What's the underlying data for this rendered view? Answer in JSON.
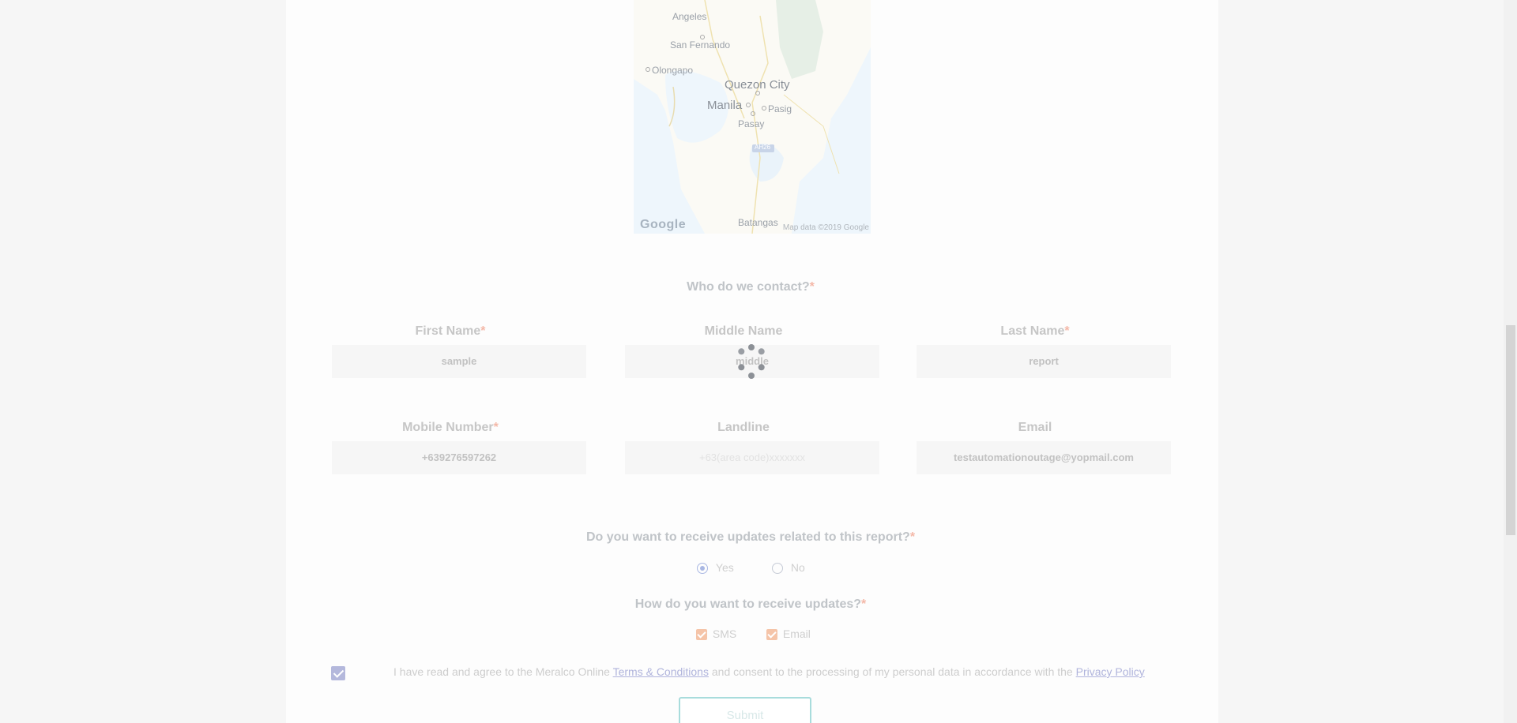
{
  "map": {
    "labels": [
      "Angeles",
      "San Fernando",
      "Olongapo",
      "Quezon City",
      "Manila",
      "Pasig",
      "Pasay",
      "AH26",
      "Batangas"
    ],
    "google_logo": "Google",
    "attribution": "Map data ©2019 Google"
  },
  "contact": {
    "title": "Who do we contact?",
    "required_mark": "*",
    "first_name": {
      "label": "First Name",
      "value": "sample"
    },
    "middle_name": {
      "label": "Middle Name",
      "value": "middle"
    },
    "last_name": {
      "label": "Last Name",
      "value": "report"
    },
    "mobile": {
      "label": "Mobile Number",
      "value": "+639276597262"
    },
    "landline": {
      "label": "Landline",
      "placeholder": "+63(area code)xxxxxxx"
    },
    "email": {
      "label": "Email",
      "value": "testautomationoutage@yopmail.com"
    }
  },
  "updates": {
    "question": "Do you want to receive updates related to this report?",
    "yes_label": "Yes",
    "no_label": "No",
    "selected": "Yes",
    "method_question": "How do you want to receive updates?",
    "sms_label": "SMS",
    "email_label": "Email"
  },
  "agreement": {
    "text_before": "I have read and agree to the Meralco Online ",
    "terms_link": "Terms & Conditions",
    "text_middle": " and consent to the processing of my personal data in accordance with the ",
    "privacy_link": "Privacy Policy",
    "checked": true
  },
  "submit_label": "Submit",
  "colors": {
    "accent": "#a9b7e3",
    "checkbox": "#f5c4a8",
    "submit_border": "#a8dcdc"
  }
}
